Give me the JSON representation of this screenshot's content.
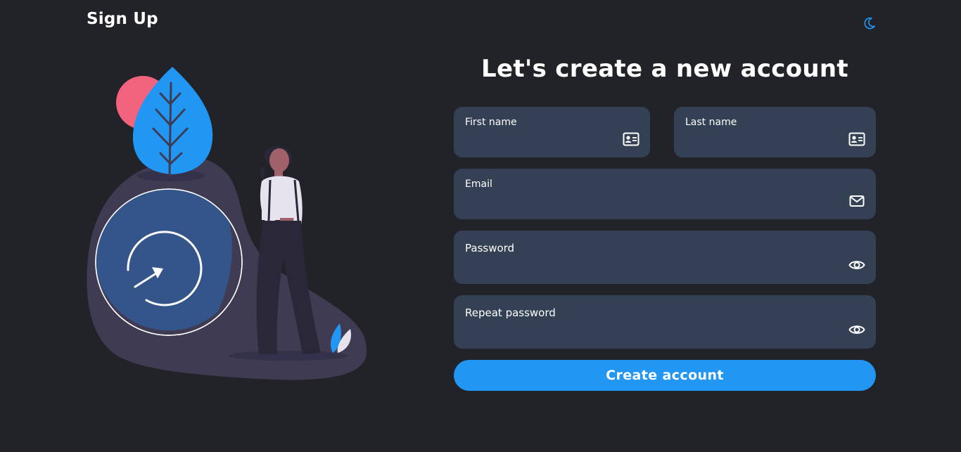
{
  "header": {
    "title": "Sign Up",
    "theme_toggle_icon": "moon-icon"
  },
  "form": {
    "heading": "Let's create a new account",
    "fields": {
      "first_name": {
        "label": "First name",
        "value": "",
        "icon": "id-card-icon"
      },
      "last_name": {
        "label": "Last name",
        "value": "",
        "icon": "id-card-icon"
      },
      "email": {
        "label": "Email",
        "value": "",
        "icon": "envelope-icon"
      },
      "password": {
        "label": "Password",
        "value": "",
        "icon": "eye-icon"
      },
      "repeat_password": {
        "label": "Repeat password",
        "value": "",
        "icon": "eye-icon"
      }
    },
    "submit_label": "Create account"
  },
  "colors": {
    "background": "#212328",
    "field_background": "#344154",
    "accent": "#2196f3",
    "text": "#ffffff"
  }
}
